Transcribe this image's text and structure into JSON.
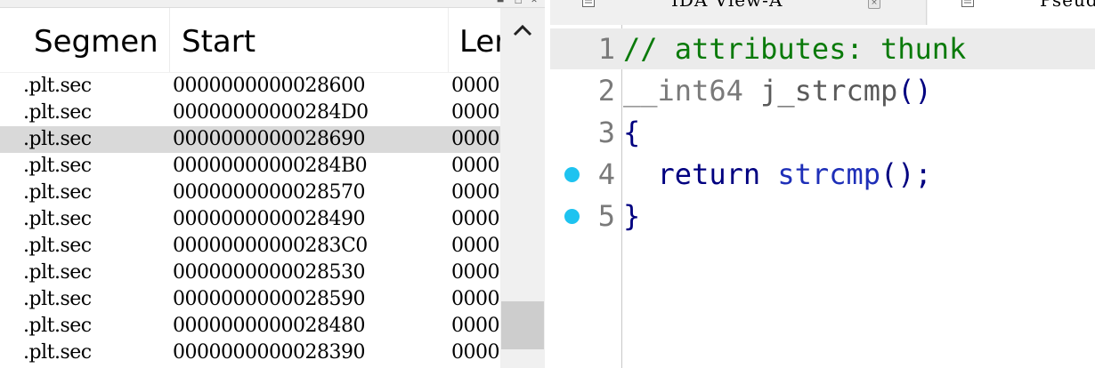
{
  "segments": {
    "columns": [
      "Segmen",
      "Start",
      "Ler"
    ],
    "rows": [
      {
        "name": ".plt.sec",
        "start": "0000000000028600",
        "length": "0000"
      },
      {
        "name": ".plt.sec",
        "start": "00000000000284D0",
        "length": "0000"
      },
      {
        "name": ".plt.sec",
        "start": "0000000000028690",
        "length": "0000",
        "selected": true
      },
      {
        "name": ".plt.sec",
        "start": "00000000000284B0",
        "length": "0000"
      },
      {
        "name": ".plt.sec",
        "start": "0000000000028570",
        "length": "0000"
      },
      {
        "name": ".plt.sec",
        "start": "0000000000028490",
        "length": "0000"
      },
      {
        "name": ".plt.sec",
        "start": "00000000000283C0",
        "length": "0000"
      },
      {
        "name": ".plt.sec",
        "start": "0000000000028530",
        "length": "0000"
      },
      {
        "name": ".plt.sec",
        "start": "0000000000028590",
        "length": "0000"
      },
      {
        "name": ".plt.sec",
        "start": "0000000000028480",
        "length": "0000"
      },
      {
        "name": ".plt.sec",
        "start": "0000000000028390",
        "length": "0000"
      }
    ]
  },
  "tabs": {
    "ida_view": "IDA View-A",
    "pseudocode": "Pseudo"
  },
  "code": {
    "lines": [
      {
        "num": "1",
        "tokens": [
          {
            "t": "// attributes: thunk",
            "c": "cmt"
          }
        ],
        "highlight": true,
        "breakpoint": false
      },
      {
        "num": "2",
        "tokens": [
          {
            "t": "__int64 ",
            "c": "kw"
          },
          {
            "t": "j_strcmp",
            "c": "fn"
          },
          {
            "t": "()",
            "c": "pu"
          }
        ],
        "highlight": false,
        "breakpoint": false
      },
      {
        "num": "3",
        "tokens": [
          {
            "t": "{",
            "c": "pu"
          }
        ],
        "highlight": false,
        "breakpoint": false
      },
      {
        "num": "4",
        "tokens": [
          {
            "t": "  return ",
            "c": "ret"
          },
          {
            "t": "strcmp",
            "c": "call"
          },
          {
            "t": "();",
            "c": "pu"
          }
        ],
        "highlight": false,
        "breakpoint": true
      },
      {
        "num": "5",
        "tokens": [
          {
            "t": "}",
            "c": "pu"
          }
        ],
        "highlight": false,
        "breakpoint": true
      }
    ]
  },
  "colors": {
    "breakpoint": "#1ec3f0",
    "comment": "#0a7a0a",
    "selected_row": "#d9d9d9",
    "highlight_line": "#ebebeb"
  }
}
